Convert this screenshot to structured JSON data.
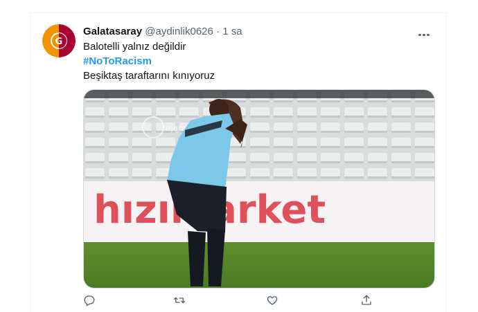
{
  "tweet": {
    "display_name": "Galatasaray",
    "handle": "@aydinlik0626",
    "separator": "·",
    "time": "1 sa",
    "line1": "Balotelli yalnız değildir",
    "hashtag": "#NoToRacism",
    "line3": "Beşiktaş taraftarını kınıyoruz"
  },
  "media": {
    "banner_text": "hızımarket",
    "watermark": "ajansbol"
  },
  "colors": {
    "link": "#1d9bf0",
    "text": "#0f1419",
    "muted": "#536471",
    "banner_red": "#e0505a",
    "avatar_orange": "#f39200",
    "avatar_red": "#a90432"
  },
  "icons": [
    "galatasaray-logo",
    "more-icon",
    "reply-icon",
    "retweet-icon",
    "like-icon",
    "share-icon"
  ]
}
